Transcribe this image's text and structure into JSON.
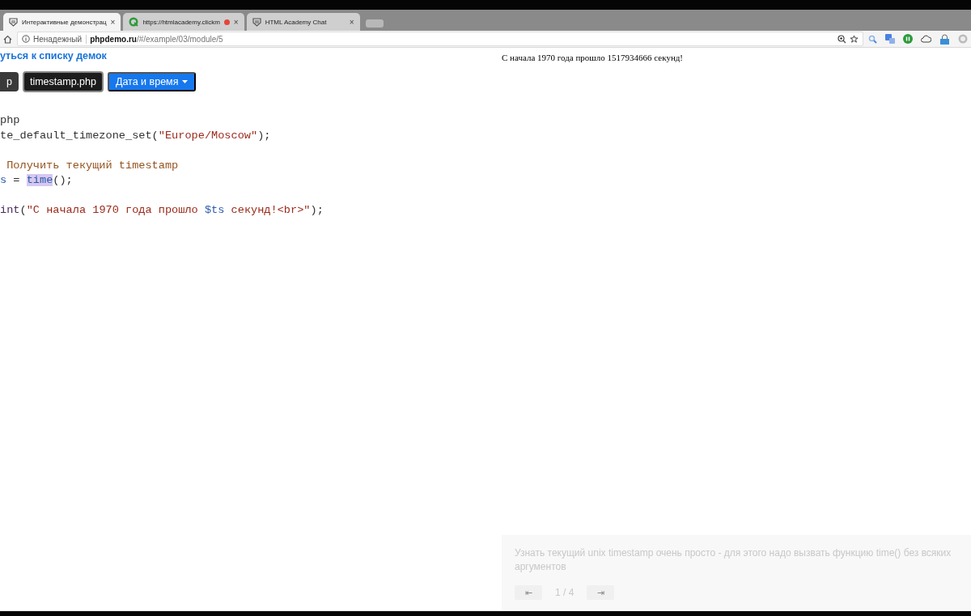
{
  "browser": {
    "tabs": [
      {
        "title": "Интерактивные демонстрац",
        "kind": "shield",
        "selected": true,
        "recording": false,
        "close": "×"
      },
      {
        "title": "https://htmlacademy.clickm",
        "kind": "ring",
        "selected": false,
        "recording": true,
        "close": "×"
      },
      {
        "title": "HTML Academy Chat",
        "kind": "shield",
        "selected": false,
        "recording": false,
        "close": "×"
      }
    ],
    "address": {
      "security": "Ненадежный",
      "host": "phpdemo.ru",
      "path": "/#/example/03/module/5"
    }
  },
  "page": {
    "back_link": "уться к списку демок",
    "files": [
      {
        "label": "p",
        "selected": false
      },
      {
        "label": "timestamp.php",
        "selected": true
      }
    ],
    "topic_dropdown": "Дата и время",
    "code_lines": [
      {
        "kind": "code",
        "tokens": [
          {
            "kind": "plain",
            "text": "php"
          }
        ]
      },
      {
        "kind": "code",
        "tokens": [
          {
            "kind": "plain",
            "text": "te_default_timezone_set("
          },
          {
            "kind": "string",
            "text": "\"Europe/Moscow\""
          },
          {
            "kind": "plain",
            "text": ");"
          }
        ]
      },
      {
        "kind": "blank"
      },
      {
        "kind": "code",
        "tokens": [
          {
            "kind": "comment",
            "text": " Получить текущий timestamp"
          }
        ]
      },
      {
        "kind": "code",
        "tokens": [
          {
            "kind": "variable",
            "text": "s"
          },
          {
            "kind": "plain",
            "text": " = "
          },
          {
            "kind": "highlight",
            "text": "time"
          },
          {
            "kind": "plain",
            "text": "();"
          }
        ]
      },
      {
        "kind": "blank"
      },
      {
        "kind": "code",
        "tokens": [
          {
            "kind": "keyword",
            "text": "int"
          },
          {
            "kind": "plain",
            "text": "("
          },
          {
            "kind": "string",
            "text": "\"С начала 1970 года прошло "
          },
          {
            "kind": "variable",
            "text": "$ts"
          },
          {
            "kind": "string",
            "text": " секунд!<br>\""
          },
          {
            "kind": "plain",
            "text": ");"
          }
        ]
      }
    ],
    "output": "С начала 1970 года прошло 1517934666 секунд!",
    "hint": {
      "text": "Узнать текущий unix timestamp очень просто - для этого надо вызвать функцию time() без всяких аргументов",
      "prev": "⇤",
      "page": "1 / 4",
      "next": "⇥"
    }
  }
}
